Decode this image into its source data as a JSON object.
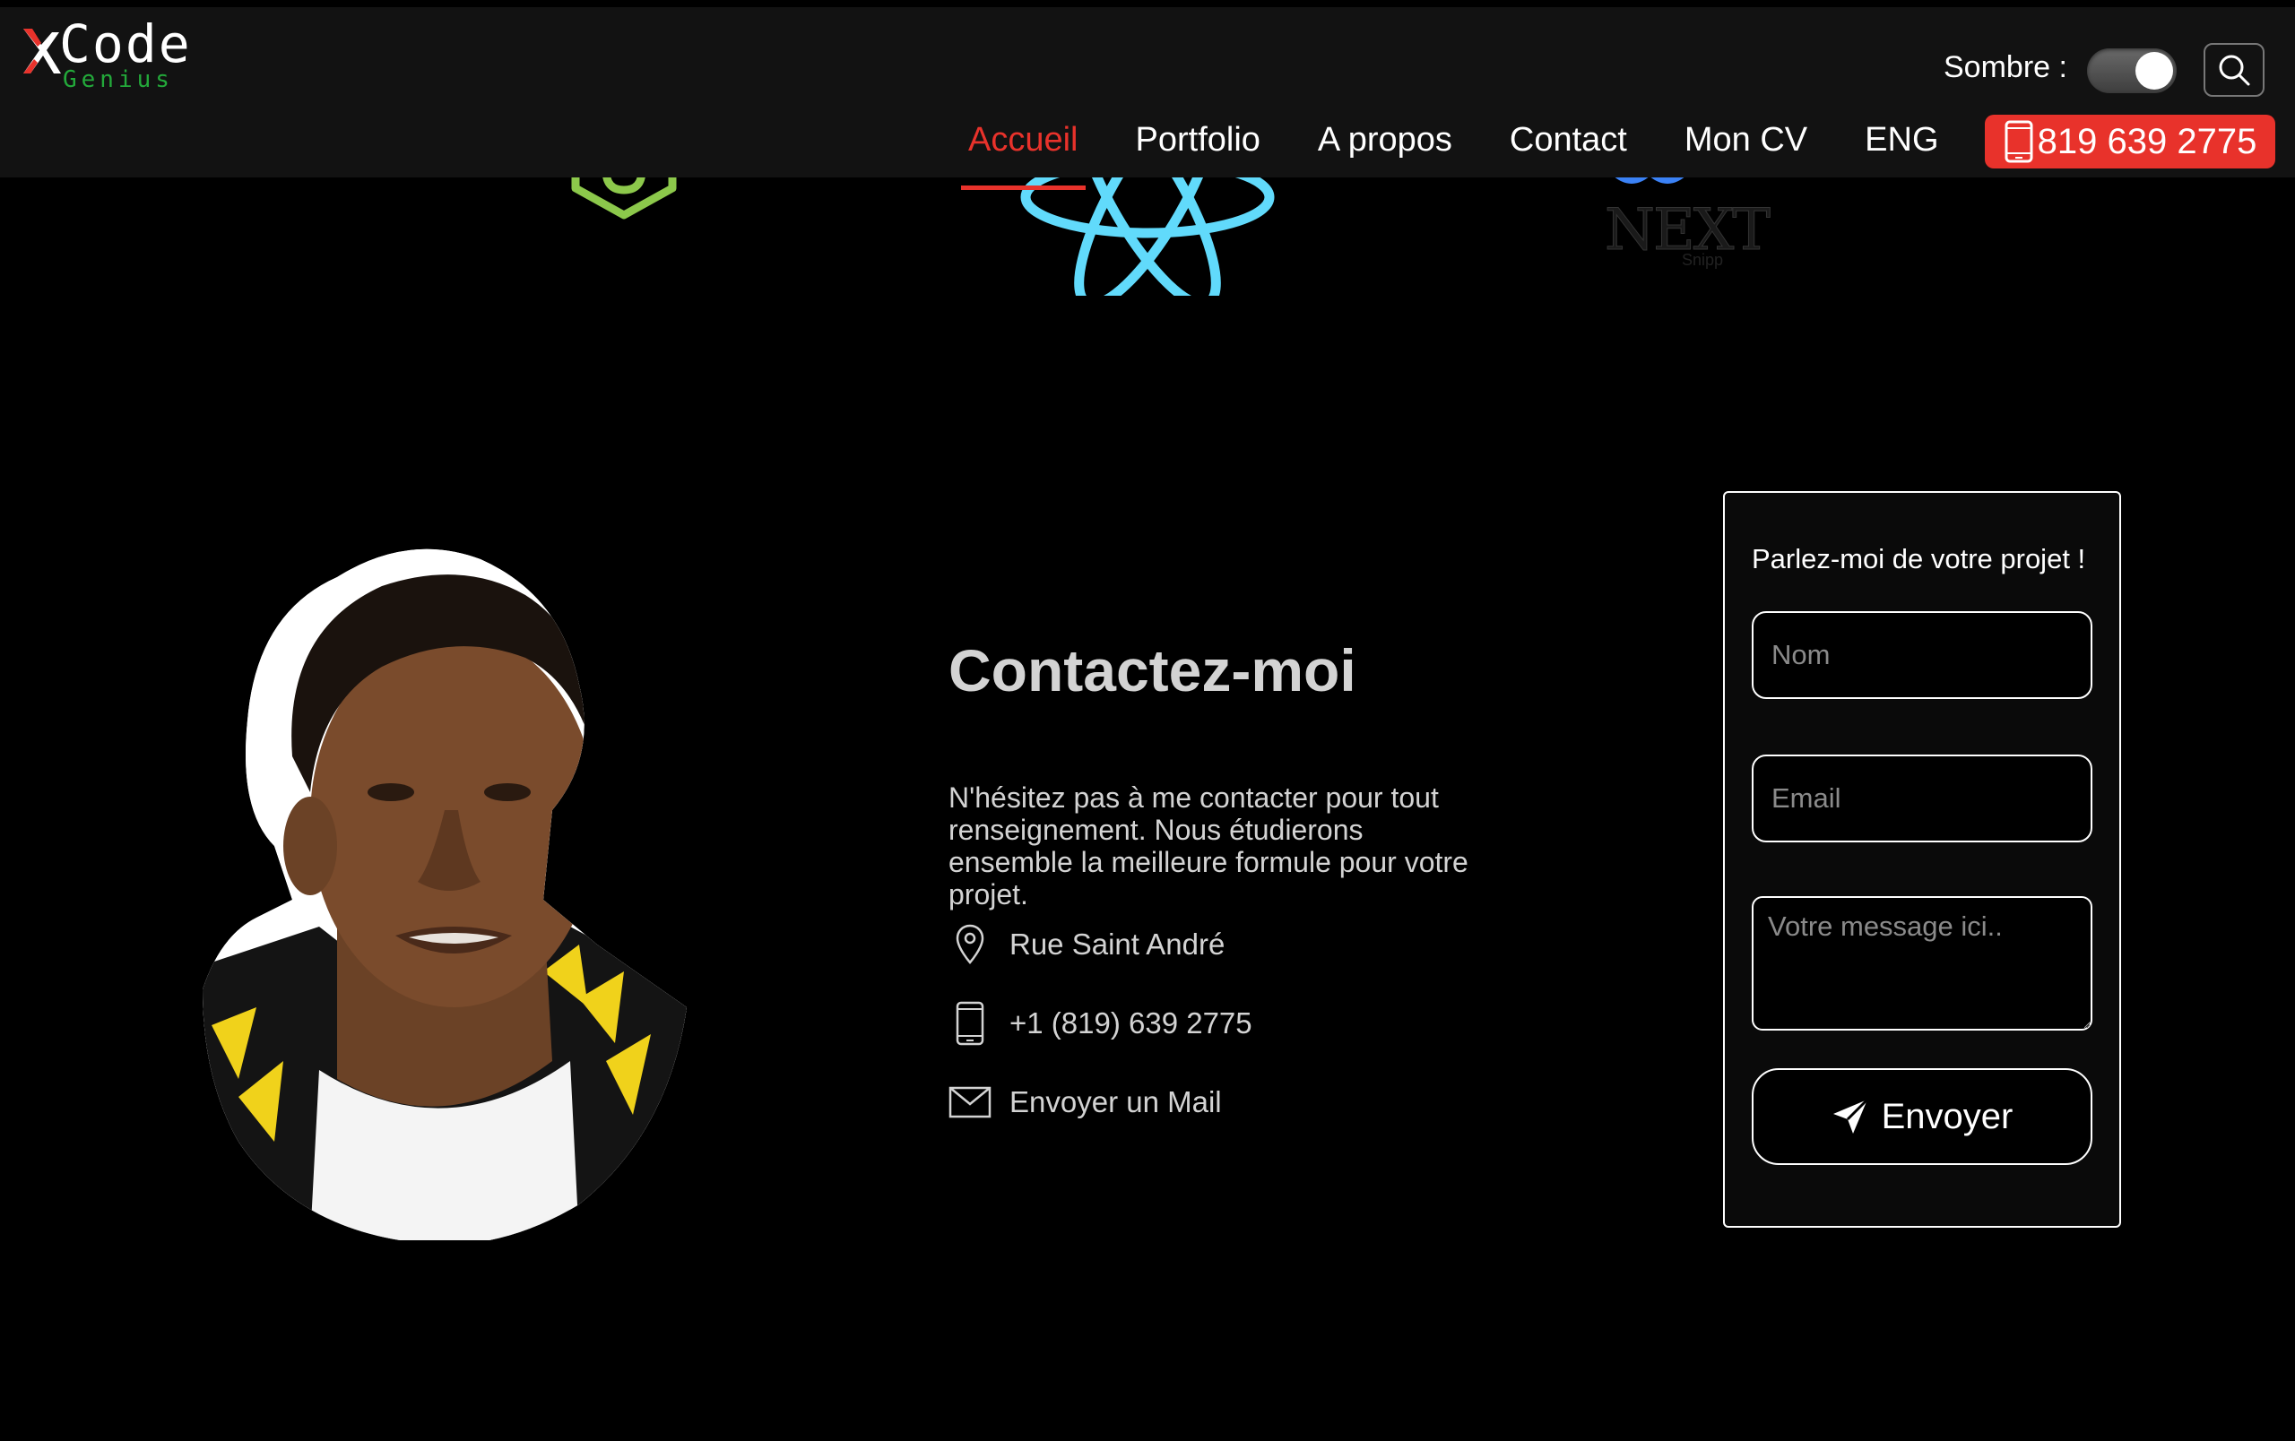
{
  "brand": {
    "logo_main": "Code",
    "logo_sub": "Genius"
  },
  "header": {
    "theme_label": "Sombre :",
    "theme_toggle_on": true,
    "nav": [
      {
        "label": "Accueil",
        "active": true
      },
      {
        "label": "Portfolio",
        "active": false
      },
      {
        "label": "A propos",
        "active": false
      },
      {
        "label": "Contact",
        "active": false
      },
      {
        "label": "Mon CV",
        "active": false
      },
      {
        "label": "ENG",
        "active": false
      }
    ],
    "phone_label": "819 639 2775"
  },
  "tech_logos": {
    "third_logo_text": "NEXT",
    "third_logo_subtext": "Snipp"
  },
  "contact": {
    "title": "Contactez-moi",
    "description": "N'hésitez pas à me contacter pour tout renseignement. Nous étudierons ensemble la meilleure formule pour votre projet.",
    "address": "Rue Saint André",
    "phone": "+1 (819) 639 2775",
    "mail_link": "Envoyer un Mail"
  },
  "form": {
    "title": "Parlez-moi de votre projet !",
    "name_placeholder": "Nom",
    "email_placeholder": "Email",
    "message_placeholder": "Votre message ici..",
    "submit_label": "Envoyer"
  },
  "colors": {
    "accent": "#e8322b",
    "brand_green": "#23a93a",
    "header_bg": "#121212",
    "page_bg": "#000000"
  }
}
